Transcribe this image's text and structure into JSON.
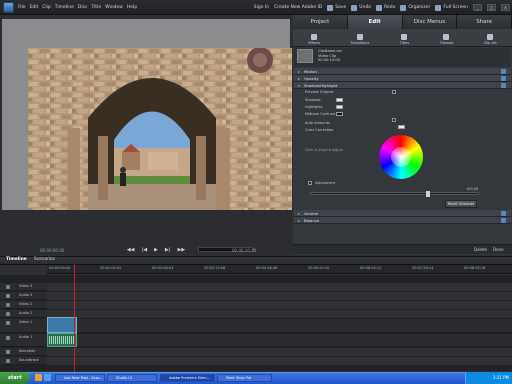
{
  "menu": [
    "File",
    "Edit",
    "Clip",
    "Timeline",
    "Disc",
    "Title",
    "Window",
    "Help"
  ],
  "account": {
    "signin": "Sign In",
    "create": "Create New Adobe ID"
  },
  "toolbar": {
    "save": "Save",
    "undo": "Undo",
    "redo": "Redo",
    "organizer": "Organizer",
    "fullscreen": "Full Screen"
  },
  "tabs": [
    "Project",
    "Edit",
    "Disc Menus",
    "Share"
  ],
  "edit_icons": [
    "Effects",
    "Transitions",
    "Titles",
    "Themes",
    "Clip Art"
  ],
  "clip": {
    "name": "ClipName.avi",
    "line2": "Video Clip",
    "line3": "00:00:10:00"
  },
  "sections": {
    "motion": "Motion",
    "opacity": "Opacity",
    "shadow": "Shadow/Highlight",
    "volume": "Volume",
    "balance": "Balance"
  },
  "props": {
    "preview": "Preview Original",
    "shadows": "Shadows",
    "highlights": "Highlights",
    "midtone": "Midtone Contrast",
    "auto": "Auto Amounts",
    "colorcorr": "Color Correction",
    "note": "Click & drag to adjust",
    "amount": "Adjustment",
    "reset": "Reset Shadows"
  },
  "slider_value": "100.00",
  "monitor": {
    "tc_left": "00:00:00:00",
    "tc_right": "00:00:10:00"
  },
  "footer": {
    "done": "Done",
    "delete": "Delete"
  },
  "timeline_tabs": [
    "Timeline",
    "Scenarios"
  ],
  "ruler": [
    "00:00:00:00",
    "00:01:04:02",
    "00:02:08:04",
    "00:03:12:06",
    "00:04:16:08",
    "00:05:20:10",
    "00:06:24:12",
    "00:07:28:14",
    "00:08:32:16"
  ],
  "tracks": [
    "Video 3",
    "Audio 3",
    "Video 2",
    "Audio 2",
    "Video 1",
    "Audio 1",
    "Narration",
    "Soundtrack"
  ],
  "taskbar": {
    "start": "start",
    "items": [
      "Add New Post - Expr...",
      "Studio UI",
      "Adobe Premiere Elem...",
      "Paint Shop Pro"
    ],
    "clock": "3:21 PM"
  },
  "colors": {
    "accent": "#5b87c6",
    "playhead": "#c2202a",
    "taskbar": "#2255cc"
  }
}
